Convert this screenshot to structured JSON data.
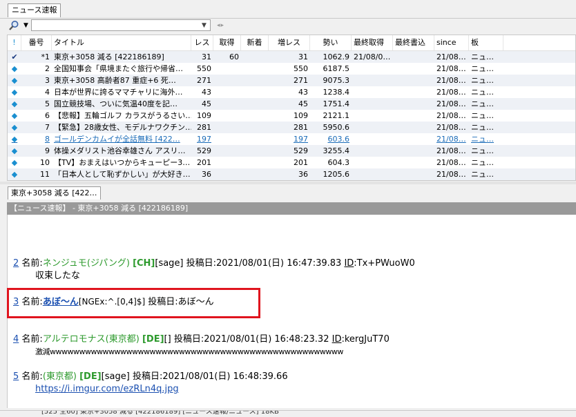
{
  "top_tab": {
    "label": "ニュース速報"
  },
  "search": {
    "placeholder": "",
    "value": ""
  },
  "list": {
    "columns": [
      "!",
      "番号",
      "タイトル",
      "レス",
      "取得",
      "新着",
      "増レス",
      "勢い",
      "最終取得",
      "最終書込",
      "since",
      "板"
    ],
    "rows": [
      {
        "mark": "✔",
        "no": "*1",
        "title": "東京+3058 減る [422186189]",
        "res": "31",
        "get": "60",
        "new": "",
        "inc": "31",
        "ikio": "1062.9",
        "last": "21/08/0…",
        "lastw": "",
        "since": "21/08…",
        "ita": "ニュ…"
      },
      {
        "mark": "◆",
        "no": "2",
        "title": "全国知事会「県境またぐ旅行や帰省…",
        "res": "550",
        "get": "",
        "new": "",
        "inc": "550",
        "ikio": "6187.5",
        "last": "",
        "lastw": "",
        "since": "21/08…",
        "ita": "ニュ…"
      },
      {
        "mark": "◆",
        "no": "3",
        "title": "東京+3058 高齢者87 重症+6 死…",
        "res": "271",
        "get": "",
        "new": "",
        "inc": "271",
        "ikio": "9075.3",
        "last": "",
        "lastw": "",
        "since": "21/08…",
        "ita": "ニュ…"
      },
      {
        "mark": "◆",
        "no": "4",
        "title": "日本が世界に誇るママチャリに海外…",
        "res": "43",
        "get": "",
        "new": "",
        "inc": "43",
        "ikio": "1238.4",
        "last": "",
        "lastw": "",
        "since": "21/08…",
        "ita": "ニュ…"
      },
      {
        "mark": "◆",
        "no": "5",
        "title": "国立競技場、ついに気温40度を記…",
        "res": "45",
        "get": "",
        "new": "",
        "inc": "45",
        "ikio": "1751.4",
        "last": "",
        "lastw": "",
        "since": "21/08…",
        "ita": "ニュ…"
      },
      {
        "mark": "◆",
        "no": "6",
        "title": "【悲報】五輪ゴルフ カラスがうるさい…",
        "res": "109",
        "get": "",
        "new": "",
        "inc": "109",
        "ikio": "2121.1",
        "last": "",
        "lastw": "",
        "since": "21/08…",
        "ita": "ニュ…"
      },
      {
        "mark": "◆",
        "no": "7",
        "title": "【緊急】28歳女性、モデルナワクチン…",
        "res": "281",
        "get": "",
        "new": "",
        "inc": "281",
        "ikio": "5950.6",
        "last": "",
        "lastw": "",
        "since": "21/08…",
        "ita": "ニュ…"
      },
      {
        "mark": "◆",
        "no": "8",
        "title": "ゴールデンカムイが全話無料 [422…",
        "res": "197",
        "get": "",
        "new": "",
        "inc": "197",
        "ikio": "603.6",
        "last": "",
        "lastw": "",
        "since": "21/08…",
        "ita": "ニュ…",
        "link": true
      },
      {
        "mark": "◆",
        "no": "9",
        "title": "体操メダリスト池谷幸雄さん アスリ…",
        "res": "529",
        "get": "",
        "new": "",
        "inc": "529",
        "ikio": "3255.4",
        "last": "",
        "lastw": "",
        "since": "21/08…",
        "ita": "ニュ…"
      },
      {
        "mark": "◆",
        "no": "10",
        "title": "【TV】おまえはいつからキューピー3…",
        "res": "201",
        "get": "",
        "new": "",
        "inc": "201",
        "ikio": "604.3",
        "last": "",
        "lastw": "",
        "since": "21/08…",
        "ita": "ニュ…"
      },
      {
        "mark": "◆",
        "no": "11",
        "title": "「日本人として恥ずかしい」が大好き…",
        "res": "36",
        "get": "",
        "new": "",
        "inc": "36",
        "ikio": "1205.6",
        "last": "",
        "lastw": "",
        "since": "21/08…",
        "ita": "ニュ…"
      }
    ]
  },
  "thread_tab": {
    "label": "東京+3058 減る [422…"
  },
  "thread_header": "【ニュース速報】 - 東京+3058 減る [422186189]",
  "posts": [
    {
      "num": "2",
      "label": "名前:",
      "name": "ネンジュモ(ジパング)",
      "tag": "[CH]",
      "mail": "[sage]",
      "date_label": " 投稿日:",
      "date": "2021/08/01(日) 16:47:39.83 ",
      "id_label": "ID",
      "id": ":Tx+PWuoW0",
      "body": "収束したな"
    },
    {
      "num": "3",
      "label": "名前:",
      "name": "あぼ～ん",
      "mail": "[NGEx:^.[0,4]$]",
      "date_label": " 投稿日:",
      "date": "あぼ～ん"
    },
    {
      "num": "4",
      "label": "名前:",
      "name": "アルテロモナス(東京都)",
      "tag": "[DE]",
      "mail": "[]",
      "date_label": " 投稿日:",
      "date": "2021/08/01(日) 16:48:23.32 ",
      "id_label": "ID",
      "id": ":kergJuT70",
      "body": "激減wwwwwwwwwwwwwwwwwwwwwwwwwwwwwwwwwwwwwwwwwwwwwwwwww"
    },
    {
      "num": "5",
      "label": "名前:",
      "name": "(東京都)",
      "tag": "[DE]",
      "mail": "[sage]",
      "date_label": " 投稿日:",
      "date": "2021/08/01(日) 16:48:39.66",
      "link": "https://i.imgur.com/ezRLn4q.jpg"
    }
  ],
  "statusbar": "[525 全60] 東京+3058 減る [422186189] [ニュース速報/ニュース] 18KB",
  "colors": {
    "highlight_box": "#e0141e",
    "name_green": "#2d9a2d",
    "link_blue": "#1a4fb0"
  }
}
